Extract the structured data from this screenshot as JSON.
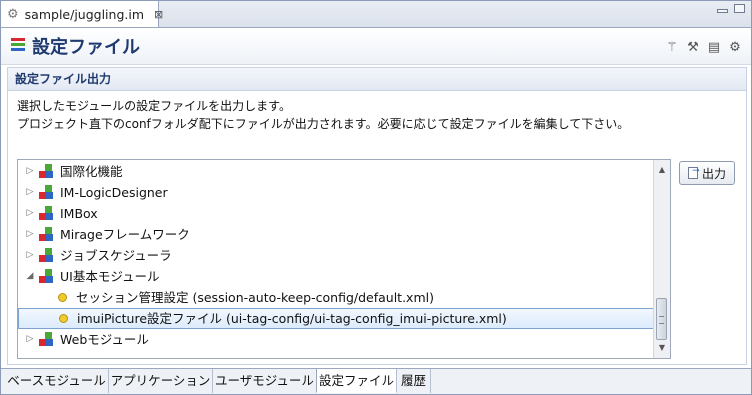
{
  "editor_tab": {
    "title": "sample/juggling.im",
    "close": "⊠"
  },
  "header": {
    "title": "設定ファイル"
  },
  "section": {
    "title": "設定ファイル出力",
    "desc_line1": "選択したモジュールの設定ファイルを出力します。",
    "desc_line2": "プロジェクト直下のconfフォルダ配下にファイルが出力されます。必要に応じて設定ファイルを編集して下さい。"
  },
  "tree": {
    "items": [
      {
        "label": "国際化機能",
        "type": "module",
        "state": "collapsed"
      },
      {
        "label": "IM-LogicDesigner",
        "type": "module",
        "state": "collapsed"
      },
      {
        "label": "IMBox",
        "type": "module",
        "state": "collapsed"
      },
      {
        "label": "Mirageフレームワーク",
        "type": "module",
        "state": "collapsed"
      },
      {
        "label": "ジョブスケジューラ",
        "type": "module",
        "state": "collapsed"
      },
      {
        "label": "UI基本モジュール",
        "type": "module",
        "state": "expanded"
      },
      {
        "label": "セッション管理設定 (session-auto-keep-config/default.xml)",
        "type": "file",
        "state": "leaf"
      },
      {
        "label": "imuiPicture設定ファイル (ui-tag-config/ui-tag-config_imui-picture.xml)",
        "type": "file",
        "state": "leaf",
        "selected": true
      },
      {
        "label": "Webモジュール",
        "type": "module",
        "state": "collapsed"
      }
    ]
  },
  "output_button": {
    "label": "出力"
  },
  "bottom_tabs": [
    {
      "label": "ベースモジュール",
      "active": false
    },
    {
      "label": "アプリケーション",
      "active": false
    },
    {
      "label": "ユーザモジュール",
      "active": false
    },
    {
      "label": "設定ファイル",
      "active": true
    },
    {
      "label": "履歴",
      "active": false
    }
  ],
  "colors": {
    "accent": "#1f3a6e",
    "selection": "#dcebfc",
    "module_red": "#d9262f",
    "module_green": "#4aa936",
    "module_blue": "#2e66c5",
    "file_dot": "#f1cb2c"
  }
}
